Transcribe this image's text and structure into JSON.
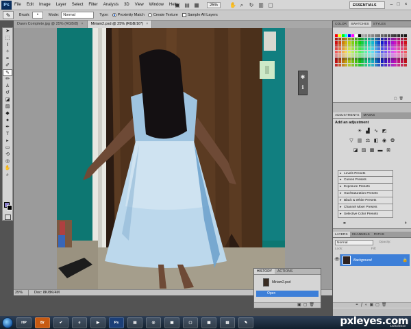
{
  "menubar": {
    "app_icon": "Ps",
    "items": [
      "File",
      "Edit",
      "Image",
      "Layer",
      "Select",
      "Filter",
      "Analysis",
      "3D",
      "View",
      "Window",
      "Help"
    ],
    "zoom": "25%",
    "workspace": "ESSENTIALS"
  },
  "options": {
    "brush_label": "Brush:",
    "brush_size": "",
    "mode_label": "Mode:",
    "mode_value": "Normal",
    "type_label": "Type:",
    "type_opt1": "Proximity Match",
    "type_opt2": "Create Texture",
    "sample_all": "Sample All Layers"
  },
  "tabs": [
    {
      "label": "Dawn Complete.jpg @ 25% (RGB/8)",
      "active": false
    },
    {
      "label": "Miriam2.psd @ 25% (RGB/16*)",
      "active": true
    }
  ],
  "status": {
    "zoom": "25%",
    "doc": "Doc: 8K/8K/4M"
  },
  "history": {
    "tab_history": "HISTORY",
    "tab_actions": "ACTIONS",
    "snapshot": "Miriam2.psd",
    "state": "Open"
  },
  "right_panels": {
    "swatch_tabs": [
      "COLOR",
      "SWATCHES",
      "STYLES"
    ],
    "adj_tabs": [
      "ADJUSTMENTS",
      "MASKS"
    ],
    "adj_title": "Add an adjustment",
    "presets": [
      "Levels Presets",
      "Curves Presets",
      "Exposure Presets",
      "Hue/Saturation Presets",
      "Black & White Presets",
      "Channel Mixer Presets",
      "Selective Color Presets"
    ],
    "layer_tabs": [
      "LAYERS",
      "CHANNELS",
      "PATHS"
    ],
    "blend_mode": "Normal",
    "opacity_label": "Opacity:",
    "lock_label": "Lock:",
    "fill_label": "Fill:",
    "layer_name": "Background"
  },
  "taskbar": {
    "buttons": [
      "HP",
      "Br",
      "",
      "",
      "",
      "Ps",
      "",
      "",
      "",
      "",
      "",
      ""
    ],
    "watermark": "pxleyes.com",
    "date": "10/22/2010"
  },
  "colors": {
    "accent": "#3d7fd8",
    "foreground": "#8a7fc9",
    "background": "#000000",
    "wall": "#0d7772",
    "curtain": "#5b3b22",
    "dress": "#bcd8ec"
  }
}
